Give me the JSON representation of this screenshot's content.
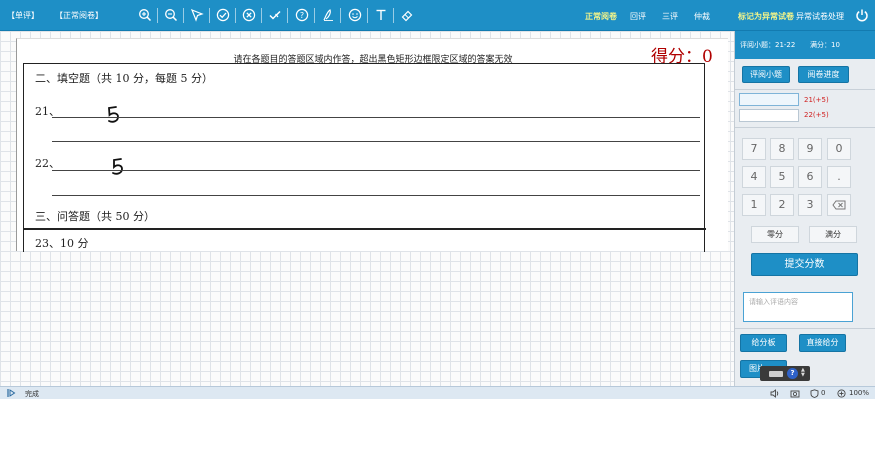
{
  "toolbar": {
    "mode_single": "【单评】",
    "mode_normal": "【正常阅卷】",
    "tools": [
      "zoom-in-icon",
      "zoom-out-icon",
      "pointer-icon",
      "correct-icon",
      "wrong-icon",
      "half-check-icon",
      "question-icon",
      "pen-icon",
      "emoji-icon",
      "text-icon",
      "eraser-icon"
    ],
    "links": [
      "正常阅卷",
      "回评",
      "三评",
      "仲裁",
      "标记为异常试卷",
      "异常试卷处理"
    ],
    "active_link": "正常阅卷",
    "power_icon": "power-icon"
  },
  "paper": {
    "notice": "请在各题目的答题区域内作答，超出黑色矩形边框限定区域的答案无效",
    "score_mark": "得分：0",
    "section2_title": "二、填空题（共 10 分，每题 5 分）",
    "q21_label": "21、",
    "q22_label": "22、",
    "q21_answer": "5",
    "q22_answer": "5",
    "section3_title": "三、问答题（共 50 分）",
    "q23_label": "23、10 分"
  },
  "panel": {
    "header_question": "评阅小题：21-22",
    "header_full": "满分：10",
    "btn_review_item": "评阅小题",
    "btn_progress": "阅卷进度",
    "question_rows": [
      "21(+5)",
      "22(+5)"
    ],
    "keypad": [
      "7",
      "8",
      "9",
      "0",
      "4",
      "5",
      "6",
      ".",
      "1",
      "2",
      "3"
    ],
    "backspace_icon": "backspace-icon",
    "zero_btn": "零分",
    "full_btn": "满分",
    "submit_btn": "提交分数",
    "comment_placeholder": "请输入评语内容",
    "give_board_btn": "给分板",
    "direct_give_btn": "直接给分",
    "image_btn": "图片"
  },
  "status": {
    "done_text": "完成",
    "right_count": "0",
    "zoom": "100%"
  },
  "colors": {
    "accent": "#1e8fc6",
    "score_red": "#b00000",
    "active_link": "#f3f58a"
  }
}
